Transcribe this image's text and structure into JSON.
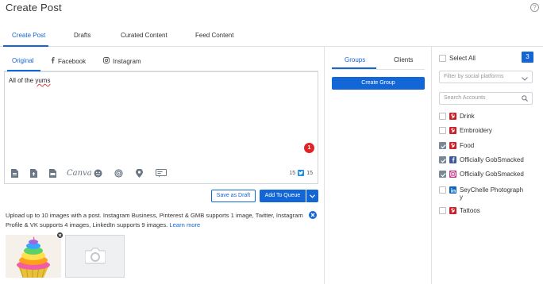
{
  "header": {
    "title": "Create Post",
    "help_icon": "question-circle-icon"
  },
  "main_tabs": [
    {
      "label": "Create Post",
      "active": true
    },
    {
      "label": "Drafts",
      "active": false
    },
    {
      "label": "Curated Content",
      "active": false
    },
    {
      "label": "Feed Content",
      "active": false
    }
  ],
  "sub_tabs": [
    {
      "label": "Original",
      "active": true
    },
    {
      "label": "Facebook",
      "icon": "facebook-icon",
      "active": false
    },
    {
      "label": "Instagram",
      "icon": "instagram-icon",
      "active": false
    }
  ],
  "editor": {
    "text_before": "All of the ",
    "text_misspelled": "yums",
    "error_count": "1",
    "char_count": "15",
    "twitter_count": "15",
    "canva_label": "Canva",
    "tools": [
      "document-icon",
      "upload-file-icon",
      "pdf-icon",
      "canva-icon",
      "emoji-icon",
      "target-icon",
      "location-pin-icon",
      "preview-icon"
    ]
  },
  "actions": {
    "save_draft": "Save as Draft",
    "add_queue": "Add To Queue"
  },
  "upload": {
    "note": "Upload up to 10 images with a post. Instagram Business, Pinterest & GMB supports 1 image, Twitter, Instagram Profile & VK supports 4 images, LinkedIn supports 9 images.",
    "learn_more": "Learn more"
  },
  "groups_panel": {
    "tabs": [
      {
        "label": "Groups",
        "active": true
      },
      {
        "label": "Clients",
        "active": false
      }
    ],
    "create_group": "Create Group"
  },
  "accounts_panel": {
    "select_all_label": "Select All",
    "selected_count": "3",
    "filter_placeholder": "Filter by social platforms",
    "search_placeholder": "Search Accounts",
    "accounts": [
      {
        "name": "Drink",
        "network": "pinterest",
        "checked": false
      },
      {
        "name": "Embroidery",
        "network": "pinterest",
        "checked": false
      },
      {
        "name": "Food",
        "network": "pinterest",
        "checked": true
      },
      {
        "name": "Officially GobSmacked",
        "network": "facebook",
        "checked": true
      },
      {
        "name": "Officially GobSmacked",
        "network": "instagram",
        "checked": true
      },
      {
        "name": "SeyChelle Photograph",
        "name_line2": "y",
        "network": "linkedin",
        "checked": false
      },
      {
        "name": "Tattoos",
        "network": "pinterest",
        "checked": false
      }
    ]
  },
  "colors": {
    "accent": "#1366d6",
    "error": "#e02424",
    "pinterest": "#cb1f27",
    "facebook": "#3b5998",
    "instagram": "#c13584",
    "linkedin": "#0a66c2",
    "twitter": "#1d8de0"
  }
}
